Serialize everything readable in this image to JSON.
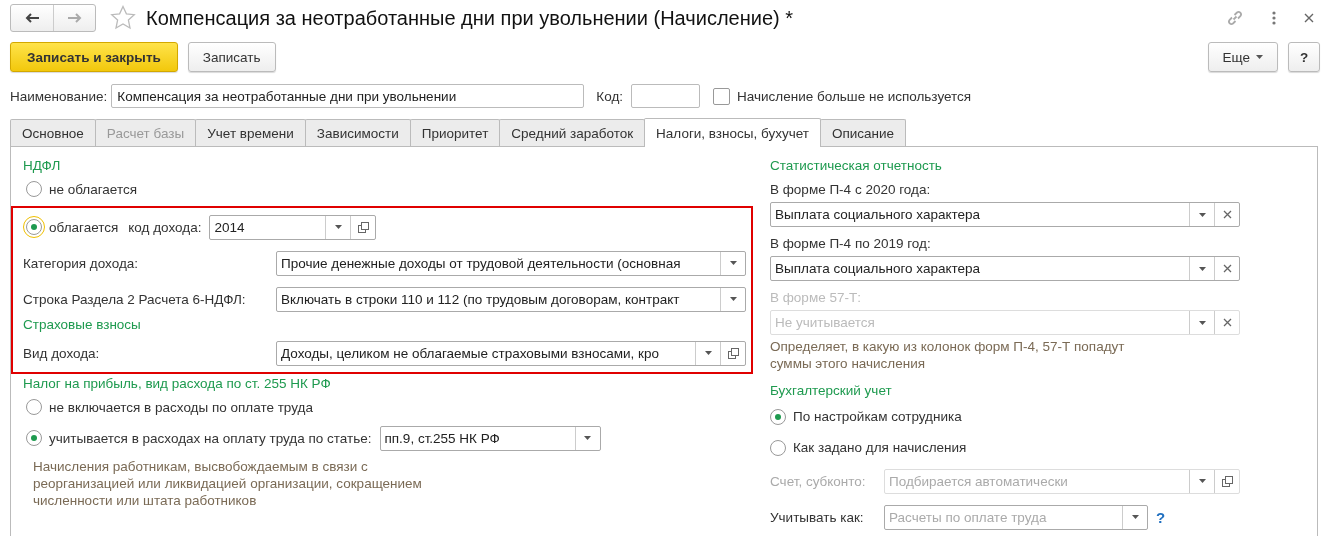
{
  "window": {
    "title": "Компенсация за неотработанные дни при увольнении (Начисление) *"
  },
  "toolbar": {
    "buttons": [
      {
        "label": "Записать и закрыть",
        "kind": "primary"
      },
      {
        "label": "Записать",
        "kind": "default"
      }
    ],
    "more": "Еще",
    "help": "?"
  },
  "header": {
    "name_label": "Наименование:",
    "name_value": "Компенсация за неотработанные дни при увольнении",
    "code_label": "Код:",
    "unused": {
      "label": "Начисление больше не используется",
      "checked": false
    }
  },
  "tabs": [
    {
      "label": "Основное",
      "selected": false,
      "disabled": false
    },
    {
      "label": "Расчет базы",
      "selected": false,
      "disabled": true
    },
    {
      "label": "Учет времени",
      "selected": false,
      "disabled": false
    },
    {
      "label": "Зависимости",
      "selected": false,
      "disabled": false
    },
    {
      "label": "Приоритет",
      "selected": false,
      "disabled": false
    },
    {
      "label": "Средний заработок",
      "selected": false,
      "disabled": false
    },
    {
      "label": "Налоги, взносы, бухучет",
      "selected": true,
      "disabled": false
    },
    {
      "label": "Описание",
      "selected": false,
      "disabled": false
    }
  ],
  "ndfl": {
    "title": "НДФЛ",
    "options": [
      {
        "label": "не облагается",
        "selected": false,
        "focused": false
      },
      {
        "label": "облагается",
        "selected": true,
        "focused": true
      }
    ],
    "code_label": "код дохода:",
    "code_value": "2014",
    "fields": [
      {
        "label": "Категория дохода:",
        "value": "Прочие денежные доходы от трудовой деятельности (основная",
        "open_button": false
      },
      {
        "label": "Строка Раздела 2 Расчета 6-НДФЛ:",
        "value": "Включать в строки 110 и 112 (по трудовым договорам, контракт",
        "open_button": false
      }
    ]
  },
  "insurance": {
    "title": "Страховые взносы",
    "label": "Вид дохода:",
    "value": "Доходы, целиком не облагаемые страховыми взносами, кро",
    "open_button": true
  },
  "profit_tax": {
    "title": "Налог на прибыль, вид расхода по ст. 255 НК РФ",
    "options": [
      {
        "label": "не включается в расходы по оплате труда",
        "selected": false
      },
      {
        "label": "учитывается в расходах на оплату труда по статье:",
        "selected": true
      }
    ],
    "article": "пп.9, ст.255 НК РФ",
    "note": "Начисления работникам, высвобождаемым в связи с реорганизацией или ликвидацией организации, сокращением численности или штата работников"
  },
  "statistics": {
    "title": "Статистическая отчетность",
    "fields": [
      {
        "label": "В форме П-4 с 2020 года:",
        "value": "Выплата социального характера",
        "disabled": false
      },
      {
        "label": "В форме П-4 по 2019 год:",
        "value": "Выплата социального характера",
        "disabled": false
      },
      {
        "label": "В форме 57-Т:",
        "placeholder": "Не учитывается",
        "disabled": true
      }
    ],
    "note": "Определяет, в какую из колонок форм П-4, 57-Т попадут суммы этого начисления"
  },
  "accounting": {
    "title": "Бухгалтерский учет",
    "options": [
      {
        "label": "По настройкам сотрудника",
        "selected": true
      },
      {
        "label": "Как задано для начисления",
        "selected": false
      }
    ],
    "account": {
      "label": "Счет, субконто:",
      "placeholder": "Подбирается автоматически",
      "disabled": true
    },
    "treat": {
      "label": "Учитывать как:",
      "placeholder": "Расчеты по оплате труда"
    },
    "help": "?"
  }
}
